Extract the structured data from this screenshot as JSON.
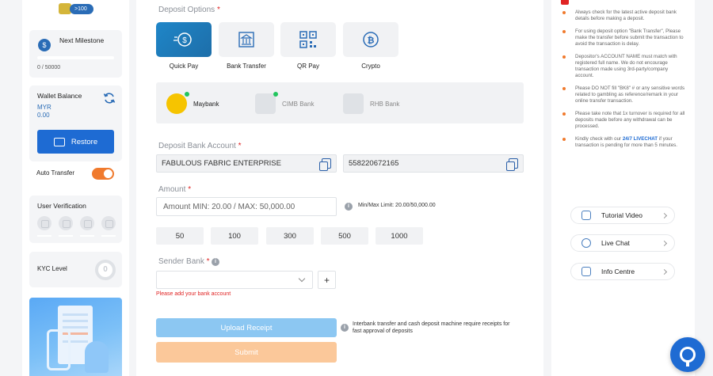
{
  "sidebar": {
    "vip_badge": ">100",
    "milestone": {
      "title": "Next Milestone",
      "value": "0 / 50000",
      "progress": 0
    },
    "wallet": {
      "label": "Wallet Balance",
      "currency": "MYR",
      "amount": "0.00",
      "restore_label": "Restore"
    },
    "auto_transfer": {
      "label": "Auto Transfer",
      "enabled": true
    },
    "verification": {
      "label": "User Verification",
      "icons": [
        "user-icon",
        "email-icon",
        "phone-icon",
        "bank-card-icon"
      ]
    },
    "kyc": {
      "label": "KYC Level",
      "level": "0"
    }
  },
  "deposit": {
    "options_title": "Deposit Options",
    "options": [
      {
        "label": "Quick Pay",
        "icon": "quick-pay-icon",
        "active": true
      },
      {
        "label": "Bank Transfer",
        "icon": "bank-icon",
        "active": false
      },
      {
        "label": "QR Pay",
        "icon": "qr-code-icon",
        "active": false
      },
      {
        "label": "Crypto",
        "icon": "bitcoin-icon",
        "active": false
      }
    ],
    "banks": [
      {
        "name": "Maybank",
        "logo": "MB",
        "color": "#f6c400"
      },
      {
        "name": "CIMB Bank",
        "logo": "CIMB",
        "color": "#d9dce0"
      },
      {
        "name": "RHB Bank",
        "logo": "RHB",
        "color": "#d9dce0"
      }
    ],
    "account_title": "Deposit Bank Account",
    "account_name": "FABULOUS FABRIC ENTERPRISE",
    "account_number": "558220672165",
    "amount_title": "Amount",
    "amount_placeholder": "Amount MIN: 20.00 / MAX: 50,000.00",
    "minmax": "Min/Max Limit: 20.00/50,000.00",
    "quick_amounts": [
      "50",
      "100",
      "300",
      "500",
      "1000"
    ],
    "sender_title": "Sender Bank",
    "sender_error": "Please add your bank account",
    "plus_label": "+",
    "upload_label": "Upload Receipt",
    "upload_note": "Interbank transfer and cash deposit machine require receipts for fast approval of deposits",
    "submit_label": "Submit"
  },
  "notices": {
    "items": [
      {
        "text": "Always check for the latest active deposit bank details before making a deposit."
      },
      {
        "text": "For using deposit option \"Bank Transfer\", Please make the transfer before submit the transaction to avoid the transaction is delay."
      },
      {
        "text": "Depositor's ACCOUNT NAME must match with registered full name. We do not encourage transaction made using 3rd-party/company account."
      },
      {
        "text": "Please DO NOT fill \"BK8\" # or any sensitive words related to gambling as reference/remark in your online transfer transaction."
      },
      {
        "text": "Please take note that 1x turnover is required for all deposits made before any withdrawal can be processed."
      }
    ],
    "livechat": {
      "before": "Kindly check with our ",
      "highlight": "24/7 LIVECHAT",
      "after": " if your transaction is pending for more than 5 minutes."
    }
  },
  "help": [
    {
      "label": "Tutorial Video",
      "icon": "video-icon"
    },
    {
      "label": "Live Chat",
      "icon": "chat-icon"
    },
    {
      "label": "Info Centre",
      "icon": "info-centre-icon"
    }
  ]
}
